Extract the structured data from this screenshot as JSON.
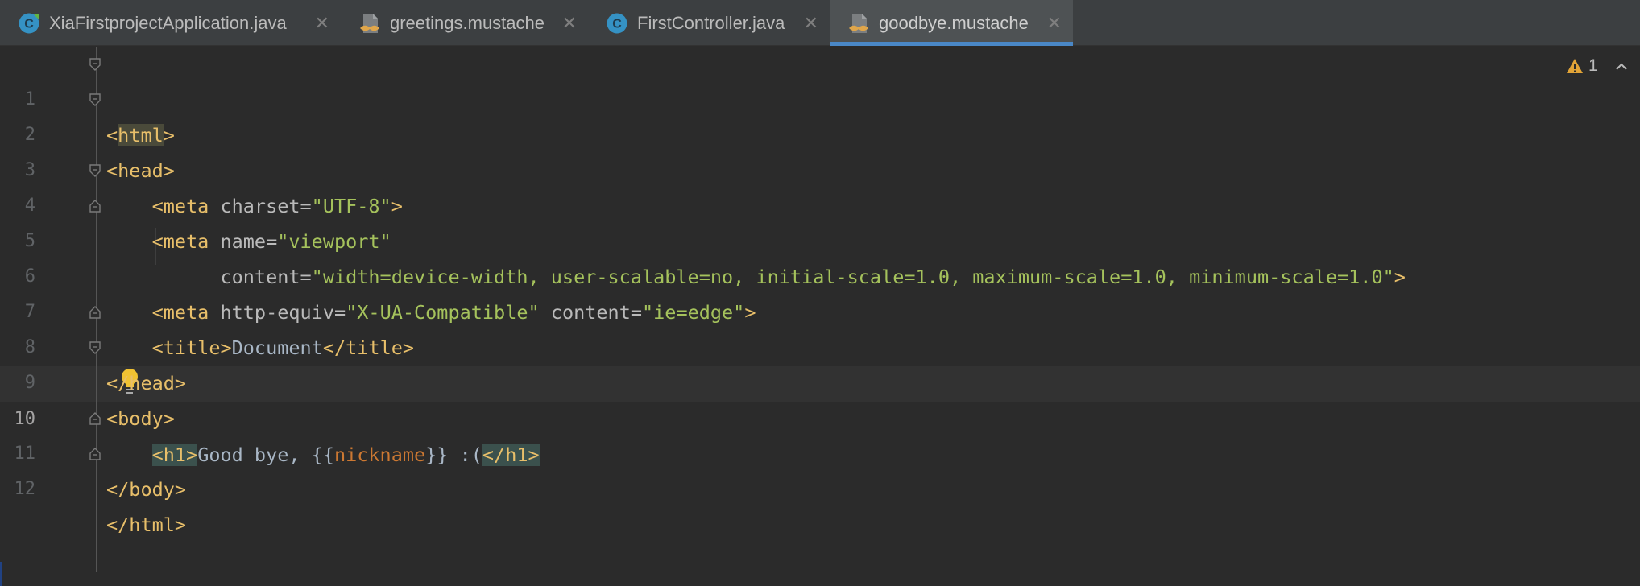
{
  "tabs": [
    {
      "label": "XiaFirstprojectApplication.java",
      "icon": "java-spring-class-icon",
      "active": false
    },
    {
      "label": "greetings.mustache",
      "icon": "mustache-file-icon",
      "active": false
    },
    {
      "label": "FirstController.java",
      "icon": "java-class-icon",
      "active": false
    },
    {
      "label": "goodbye.mustache",
      "icon": "mustache-file-icon",
      "active": true
    }
  ],
  "colors": {
    "tag": "#e8bf6a",
    "attribute": "#bababa",
    "string": "#a5c25c",
    "variable": "#cc7832",
    "text": "#a9b7c6",
    "background": "#2b2b2b",
    "active_tab_underline": "#4a88c7"
  },
  "inspection": {
    "icon": "warning-icon",
    "count": "1"
  },
  "current_line": 10,
  "lines": {
    "l1": {
      "num": "1",
      "t1": "<",
      "t2": "html",
      "t3": ">"
    },
    "l2": {
      "num": "2",
      "t1": "<head>"
    },
    "l3": {
      "num": "3",
      "indent": "    ",
      "t1": "<meta ",
      "a1": "charset=",
      "v1": "\"UTF-8\"",
      "t2": ">"
    },
    "l4": {
      "num": "4",
      "indent": "    ",
      "t1": "<meta ",
      "a1": "name=",
      "v1": "\"viewport\""
    },
    "l5": {
      "num": "5",
      "indent": "          ",
      "a1": "content=",
      "v1": "\"width=device-width, user-scalable=no, initial-scale=1.0, maximum-scale=1.0, minimum-scale=1.0\"",
      "t1": ">"
    },
    "l6": {
      "num": "6",
      "indent": "    ",
      "t1": "<meta ",
      "a1": "http-equiv=",
      "v1": "\"X-UA-Compatible\"",
      "a2": " content=",
      "v2": "\"ie=edge\"",
      "t2": ">"
    },
    "l7": {
      "num": "7",
      "indent": "    ",
      "t1": "<title>",
      "x1": "Document",
      "t2": "</title>"
    },
    "l8": {
      "num": "8",
      "t1": "</head>"
    },
    "l9": {
      "num": "9",
      "t1": "<body>"
    },
    "l10": {
      "num": "10",
      "indent": "    ",
      "t1": "<h1>",
      "x1": "Good bye, {{",
      "m1": "nickname",
      "x2": "}} :(",
      "t2": "</h1>"
    },
    "l11": {
      "num": "11",
      "t1": "</body>"
    },
    "l12": {
      "num": "12",
      "t1": "</html>"
    }
  }
}
